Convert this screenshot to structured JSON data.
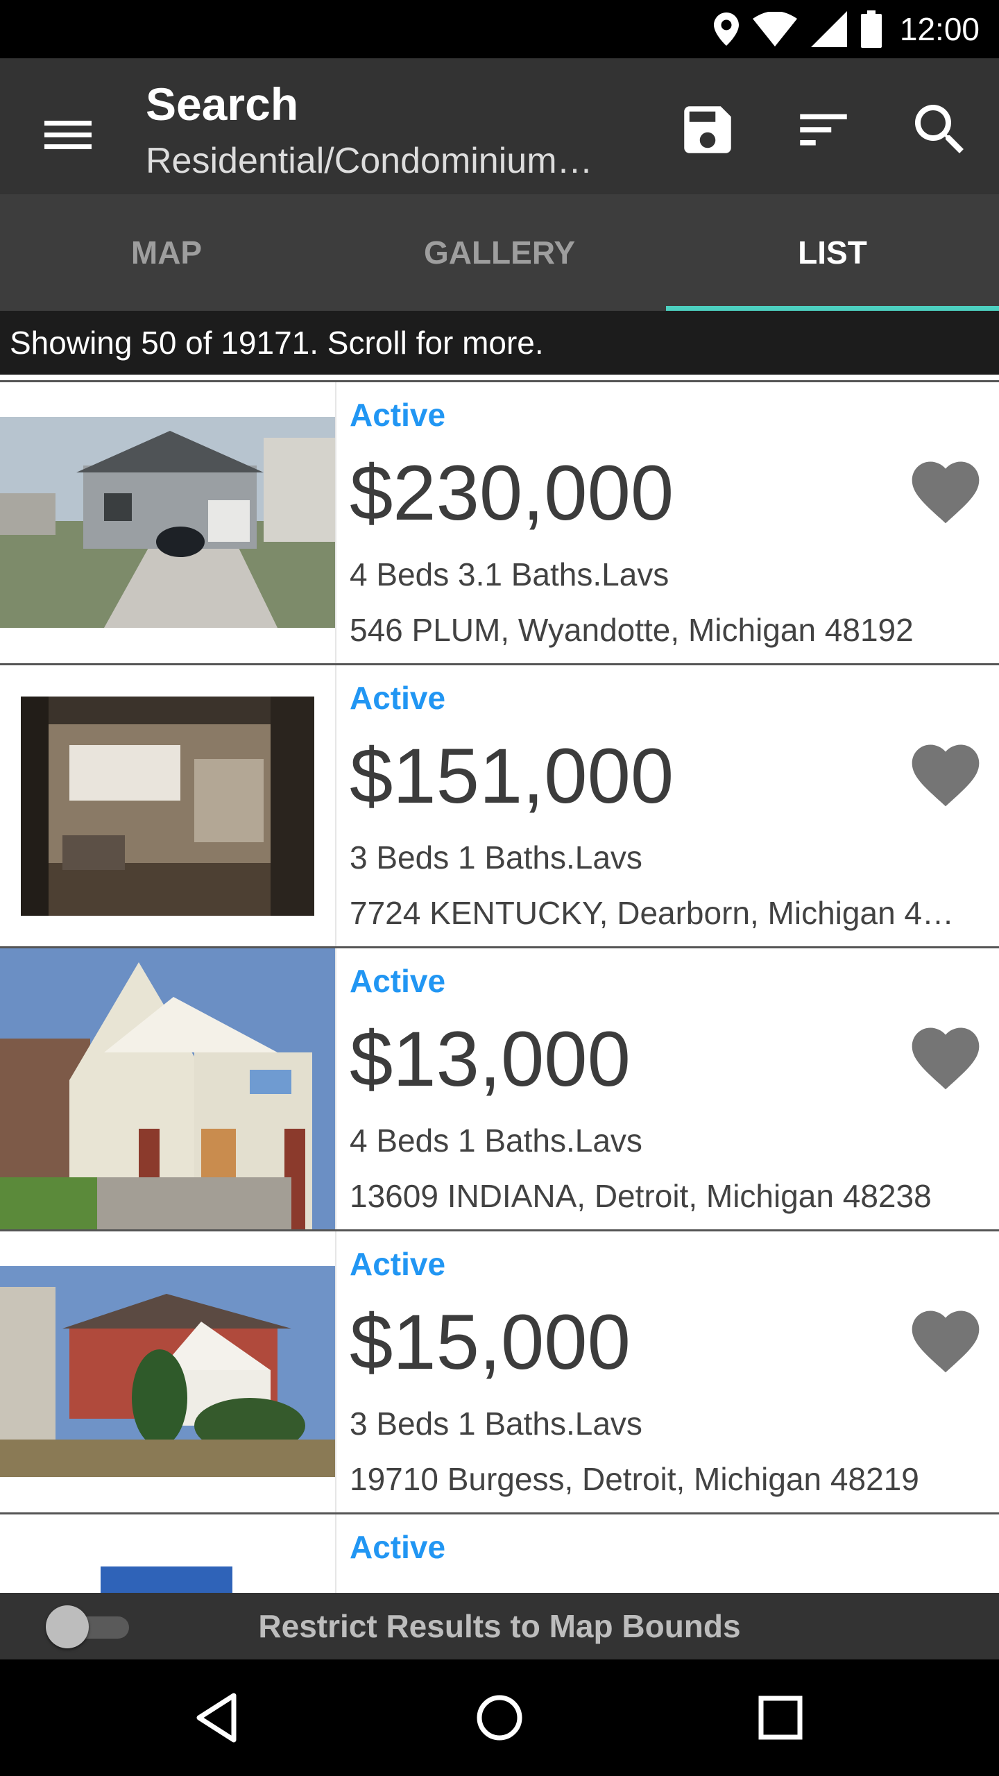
{
  "status_bar": {
    "time": "12:00",
    "icons": [
      "location-icon",
      "wifi-icon",
      "signal-icon",
      "battery-icon"
    ]
  },
  "app_bar": {
    "title": "Search",
    "subtitle": "Residential/Condominium…",
    "actions": [
      "save-icon",
      "sort-icon",
      "search-icon"
    ]
  },
  "tabs": [
    {
      "label": "MAP",
      "active": false
    },
    {
      "label": "GALLERY",
      "active": false
    },
    {
      "label": "LIST",
      "active": true
    }
  ],
  "info": {
    "text": "Showing 50 of 19171. Scroll for more."
  },
  "listings": [
    {
      "status": "Active",
      "price": "$230,000",
      "beds_baths": "4 Beds 3.1 Baths.Lavs",
      "address": "546 PLUM, Wyandotte, Michigan 48192"
    },
    {
      "status": "Active",
      "price": "$151,000",
      "beds_baths": "3 Beds 1 Baths.Lavs",
      "address": "7724 KENTUCKY, Dearborn, Michigan 4…"
    },
    {
      "status": "Active",
      "price": "$13,000",
      "beds_baths": "4 Beds 1 Baths.Lavs",
      "address": "13609 INDIANA, Detroit, Michigan 48238"
    },
    {
      "status": "Active",
      "price": "$15,000",
      "beds_baths": "3 Beds 1 Baths.Lavs",
      "address": "19710 Burgess, Detroit, Michigan 48219"
    },
    {
      "status": "Active",
      "price": "",
      "beds_baths": "",
      "address": ""
    }
  ],
  "bottom": {
    "toggle_on": false,
    "label": "Restrict Results to Map Bounds"
  },
  "colors": {
    "accent": "#4dd0c0",
    "status_active": "#2196f3",
    "app_bar": "#333333",
    "favorite": "#757575"
  }
}
